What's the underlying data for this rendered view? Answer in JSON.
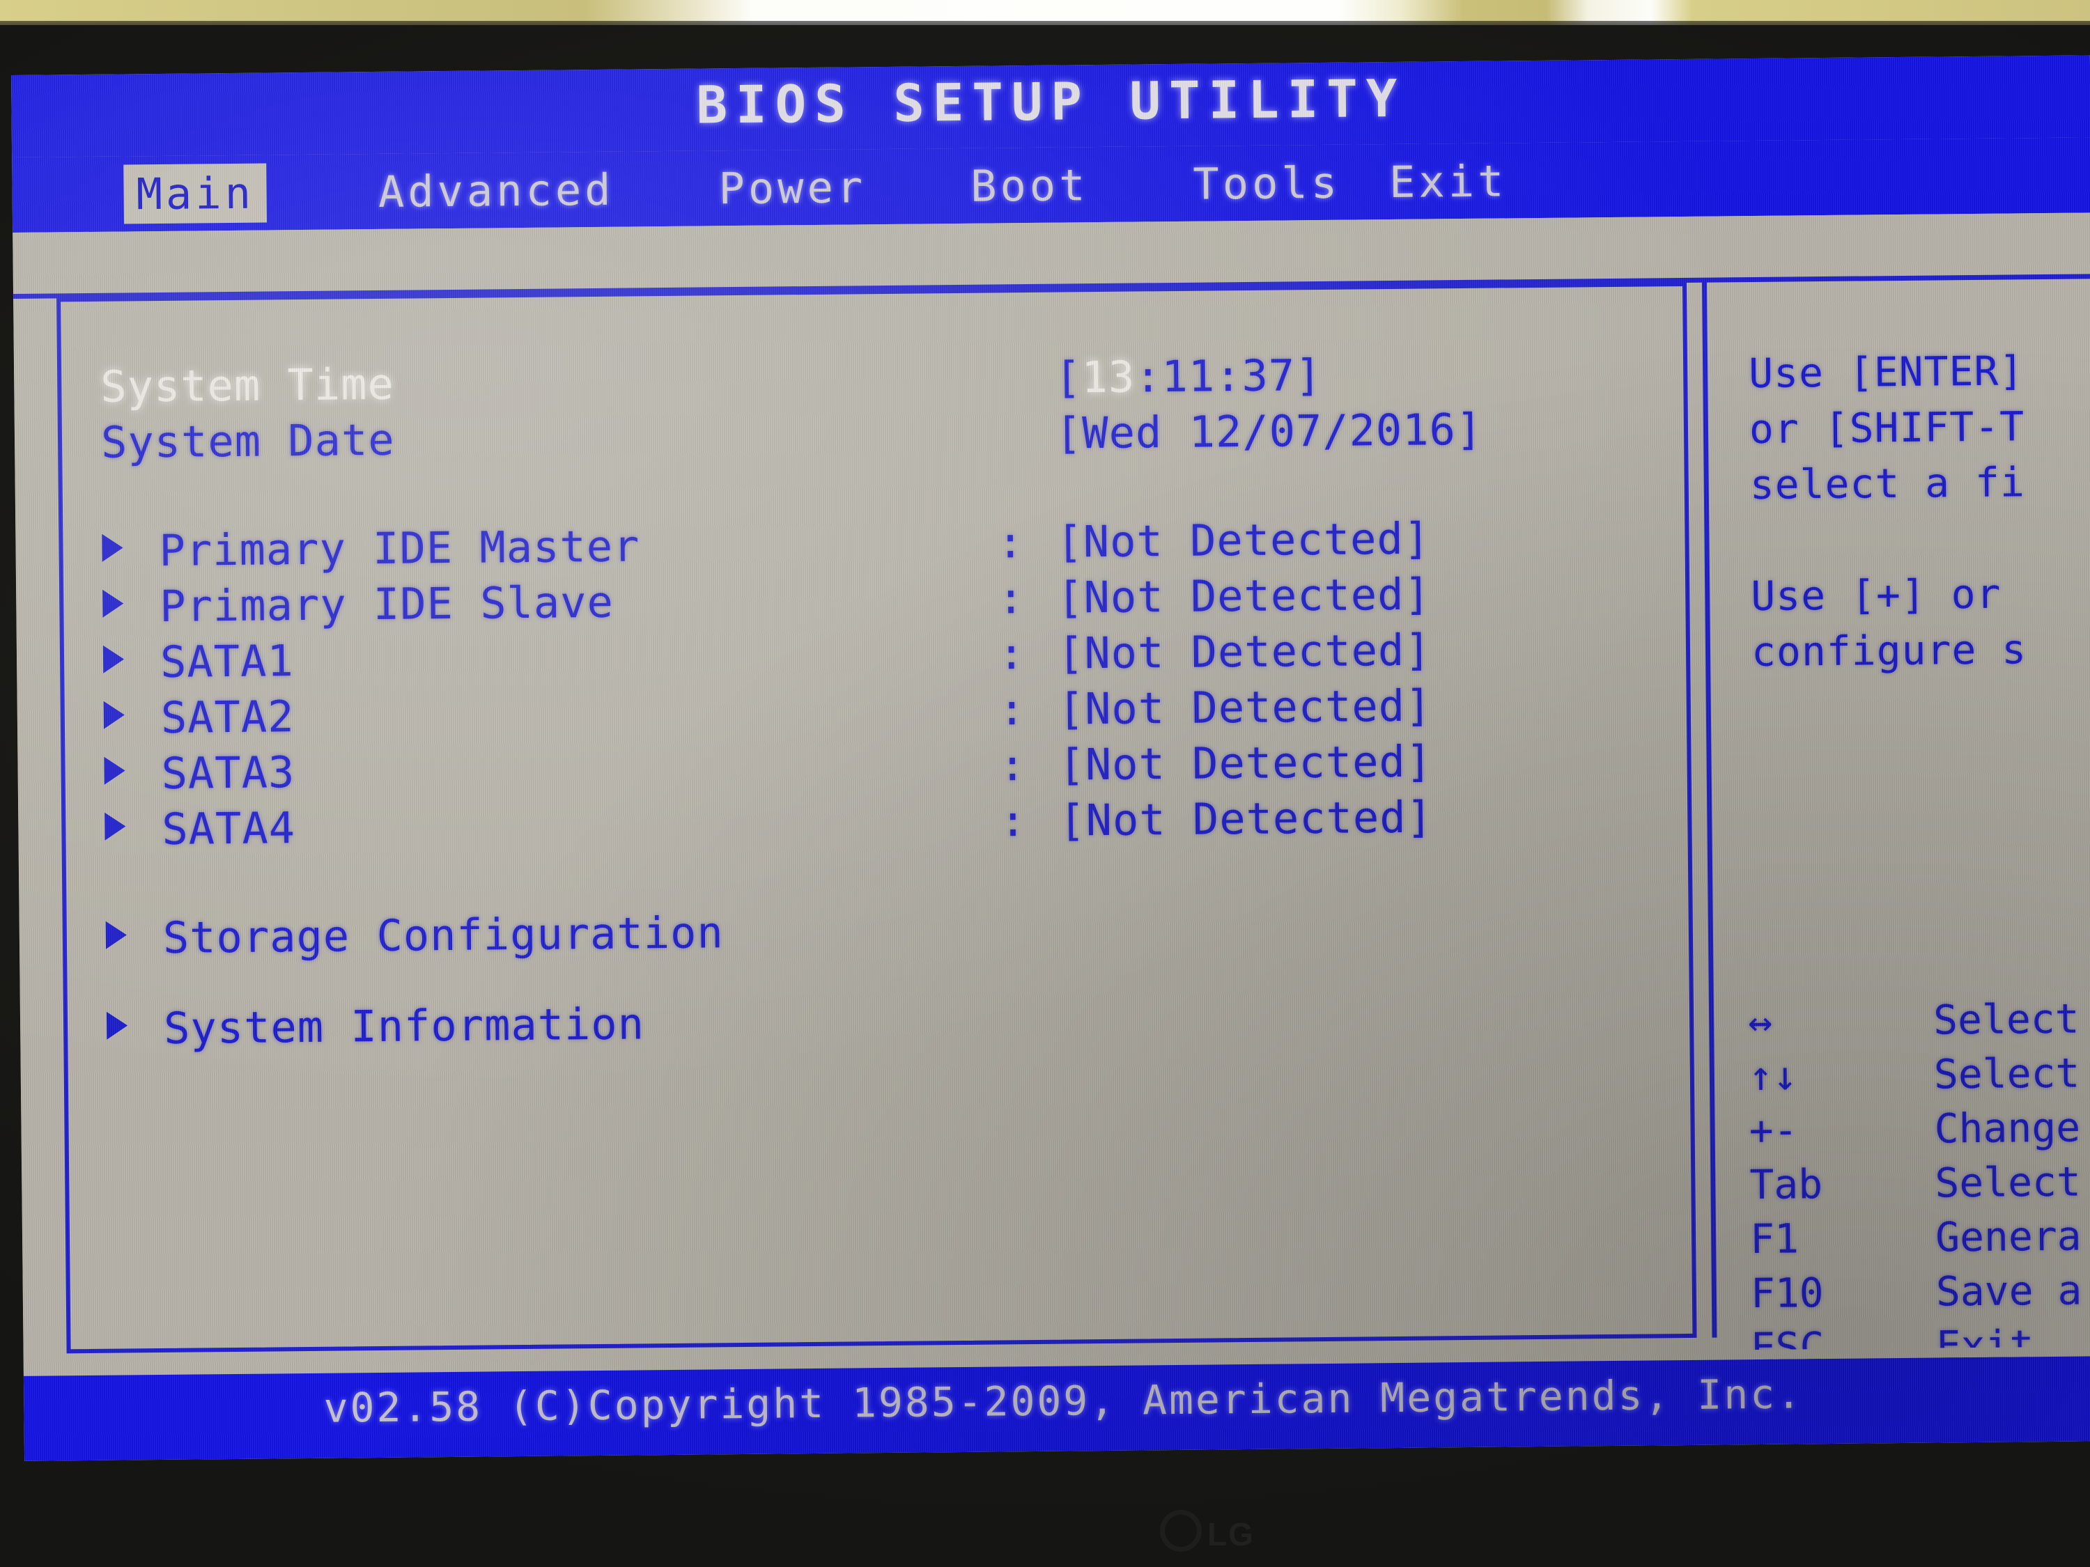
{
  "screen": {
    "title": "BIOS SETUP UTILITY",
    "accent_blue": "#1414e6",
    "text_blue": "#1c1ccf",
    "panel_gray": "#b9b5ab",
    "highlight_text": "#efece6"
  },
  "menu": {
    "tabs": [
      {
        "label": "Main",
        "active": true
      },
      {
        "label": "Advanced",
        "active": false
      },
      {
        "label": "Power",
        "active": false
      },
      {
        "label": "Boot",
        "active": false
      },
      {
        "label": "Tools",
        "active": false
      },
      {
        "label": "Exit",
        "active": false
      }
    ]
  },
  "main": {
    "system_time": {
      "label": "System Time",
      "value_open": "[",
      "value_hours": "13",
      "value_rest": ":11:37]",
      "selected": true
    },
    "system_date": {
      "label": "System Date",
      "value": "[Wed 12/07/2016]",
      "selected": false
    },
    "devices": [
      {
        "label": "Primary IDE Master",
        "colon": ":",
        "value": "[Not Detected]"
      },
      {
        "label": "Primary IDE Slave",
        "colon": ":",
        "value": "[Not Detected]"
      },
      {
        "label": "SATA1",
        "colon": ":",
        "value": "[Not Detected]"
      },
      {
        "label": "SATA2",
        "colon": ":",
        "value": "[Not Detected]"
      },
      {
        "label": "SATA3",
        "colon": ":",
        "value": "[Not Detected]"
      },
      {
        "label": "SATA4",
        "colon": ":",
        "value": "[Not Detected]"
      }
    ],
    "submenus": [
      {
        "label": "Storage Configuration"
      },
      {
        "label": "System Information"
      }
    ]
  },
  "help": {
    "lines": [
      "Use [ENTER]",
      "or [SHIFT-T",
      "select a fi"
    ],
    "lines2": [
      "Use [+] or",
      "configure s"
    ]
  },
  "key_legend": [
    {
      "key": "↔",
      "desc": "Select"
    },
    {
      "key": "↑↓",
      "desc": "Select"
    },
    {
      "key": "+-",
      "desc": "Change"
    },
    {
      "key": "Tab",
      "desc": "Select"
    },
    {
      "key": "F1",
      "desc": "Genera"
    },
    {
      "key": "F10",
      "desc": "Save a"
    },
    {
      "key": "ESC",
      "desc": "Exit"
    }
  ],
  "footer": {
    "text": "v02.58 (C)Copyright 1985-2009, American Megatrends, Inc."
  },
  "hardware": {
    "monitor_brand": "LG"
  }
}
